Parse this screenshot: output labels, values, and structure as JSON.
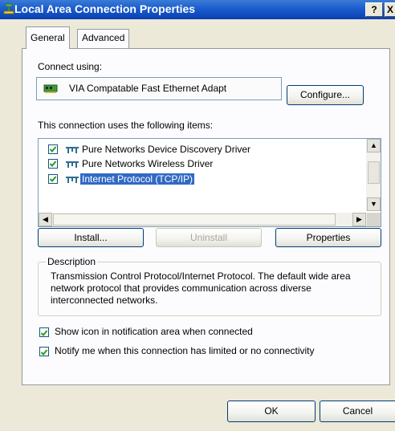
{
  "window": {
    "title": "Local Area Connection Properties",
    "help_label": "?",
    "close_label": "X"
  },
  "tabs": [
    {
      "label": "General",
      "active": true
    },
    {
      "label": "Advanced",
      "active": false
    }
  ],
  "connect_using": {
    "label": "Connect using:",
    "adapter": "VIA Compatable Fast Ethernet Adapt",
    "configure_label": "Configure..."
  },
  "items_section": {
    "label": "This connection uses the following items:",
    "items": [
      {
        "label": "Pure Networks Device Discovery Driver",
        "checked": true,
        "selected": false
      },
      {
        "label": "Pure Networks Wireless Driver",
        "checked": true,
        "selected": false
      },
      {
        "label": "Internet Protocol (TCP/IP)",
        "checked": true,
        "selected": true
      }
    ]
  },
  "item_buttons": {
    "install": "Install...",
    "uninstall": "Uninstall",
    "properties": "Properties"
  },
  "description": {
    "legend": "Description",
    "text": "Transmission Control Protocol/Internet Protocol. The default wide area network protocol that provides communication across diverse interconnected networks."
  },
  "options": {
    "show_icon": {
      "label": "Show icon in notification area when connected",
      "checked": true
    },
    "notify": {
      "label": "Notify me when this connection has limited or no connectivity",
      "checked": true
    }
  },
  "footer": {
    "ok": "OK",
    "cancel": "Cancel"
  },
  "colors": {
    "titlebar": "#0a3fb0",
    "selection": "#316ac5",
    "dialog_bg": "#ece9d8"
  }
}
